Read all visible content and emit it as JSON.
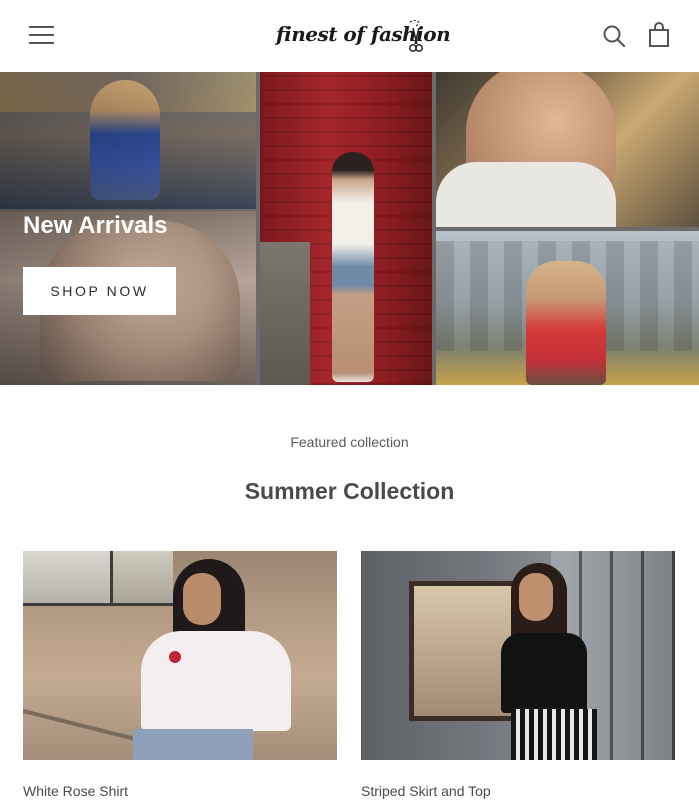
{
  "header": {
    "logo_text": "finest of fashion",
    "menu_icon": "hamburger-menu-icon",
    "search_icon": "search-icon",
    "cart_icon": "shopping-bag-icon"
  },
  "hero": {
    "title": "New Arrivals",
    "button_label": "SHOP NOW"
  },
  "featured": {
    "subtitle": "Featured collection",
    "title": "Summer Collection",
    "products": [
      {
        "name": "White Rose Shirt"
      },
      {
        "name": "Striped Skirt and Top"
      }
    ]
  },
  "colors": {
    "text": "#3d3d3d",
    "button_bg": "#ffffff",
    "background": "#ffffff"
  }
}
